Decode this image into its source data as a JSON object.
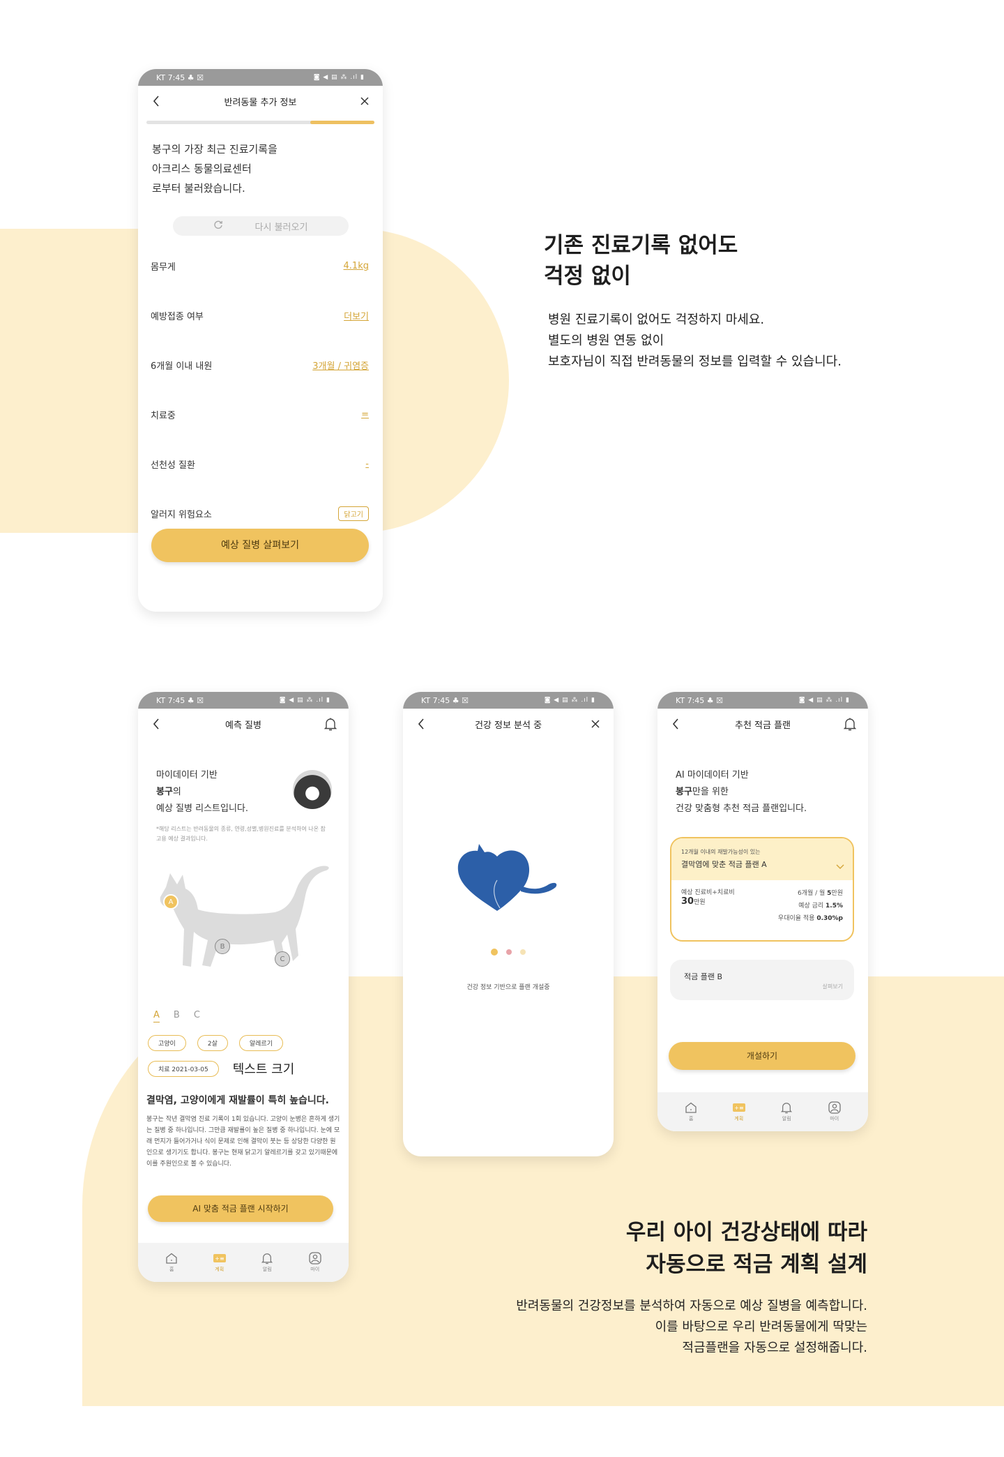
{
  "colors": {
    "accent": "#f0c35f",
    "accent_text": "#d4a537",
    "bg_cream": "#fdefcd",
    "heart_blue": "#2c5fa8"
  },
  "status_bar": {
    "left": "KT 7:45 ♣ ☒",
    "right": "◙ ◀ ▤ ⁂ .ıl ▮"
  },
  "phone1": {
    "title": "반려동물 추가 정보",
    "intro": [
      "봉구의 가장 최근 진료기록을",
      "아크리스 동물의료센터",
      "로부터 불러왔습니다."
    ],
    "reload_label": "다시 불러오기",
    "rows": [
      {
        "label": "몸무게",
        "value": "4.1kg"
      },
      {
        "label": "예방접종 여부",
        "value": "더보기"
      },
      {
        "label": "6개월 이내 내원",
        "value": "3개월 / 귀염증"
      },
      {
        "label": "치료중",
        "value": "="
      },
      {
        "label": "선천성 질환",
        "value": "-"
      },
      {
        "label": "알러지 위험요소",
        "tag": "닭고기"
      }
    ],
    "cta": "예상 질병 살펴보기"
  },
  "phone2": {
    "title": "예측 질병",
    "head": {
      "line1": "마이데이터 기반",
      "name": "봉구",
      "line2_suffix": "의",
      "line3": "예상 질병 리스트입니다."
    },
    "disclaimer": "*해당 리스트는 반려동물의 종류, 연령,성별,병원진료를 분석하여 나온 참고용 예상 결과입니다.",
    "markers": [
      "A",
      "B",
      "C"
    ],
    "tabs_abc": [
      "A",
      "B",
      "C"
    ],
    "chips": [
      "고양이",
      "2살",
      "알레르기",
      "치료 2021-03-05"
    ],
    "chip_note": "텍스트 크기",
    "result_title": "결막염, 고양이에게 재발률이 특히 높습니다.",
    "result_body": "봉구는 작년 결막염 진료 기록이 1회 있습니다. 고양이 눈병은 흔하게 생기는 질병 중 하나입니다. 그만큼 재발률이 높은 질병 중 하나입니다. 눈에 모래 먼지가 들어가거나 식이 문제로 인해 결막이 붓는 등 상당한 다양한 원인으로 생기기도 합니다. 봉구는 현재 닭고기 알레르기를 갖고 있기때문에 이를 주원인으로 볼 수 있습니다.",
    "cta": "AI 맞춤 적금 플랜 시작하기"
  },
  "tabbar": [
    {
      "label": "홈",
      "icon": "home-icon"
    },
    {
      "label": "계획",
      "icon": "plan-icon"
    },
    {
      "label": "알림",
      "icon": "bell-icon"
    },
    {
      "label": "마이",
      "icon": "profile-icon"
    }
  ],
  "phone3": {
    "title": "건강 정보 분석 중",
    "caption": "건강 정보 기반으로 플랜 개설중"
  },
  "phone4": {
    "title": "추천 적금 플랜",
    "head": {
      "line1": "AI 마이데이터 기반",
      "name": "봉구",
      "line2_suffix": "만을 위한",
      "line3": "건강 맞춤형 추천 적금 플랜입니다."
    },
    "plan_a": {
      "subtitle": "12개월 이내의 재발가능성이 있는",
      "title": "결막염에 맞춘 적금 플랜 A",
      "cost_label": "예상 진료비+치료비",
      "cost_value": "30",
      "cost_unit": "만원",
      "term_prefix": "6개월 / 월 ",
      "term_value": "5",
      "term_unit": "만원",
      "rate_prefix": "예상 금리 ",
      "rate_value": "1.5%",
      "bonus_prefix": "우대이율 적용 ",
      "bonus_value": "0.30%p"
    },
    "plan_b": {
      "title": "적금 플랜 B",
      "more": "살펴보기"
    },
    "cta": "개설하기"
  },
  "copy1": {
    "headline_line1": "기존 진료기록 없어도",
    "headline_line2": "걱정 없이",
    "body": [
      "병원 진료기록이 없어도 걱정하지 마세요.",
      "별도의 병원 연동 없이",
      "보호자님이 직접 반려동물의 정보를 입력할 수 있습니다."
    ]
  },
  "copy2": {
    "headline_line1": "우리 아이 건강상태에 따라",
    "headline_line2": "자동으로 적금 계획 설계",
    "body": [
      "반려동물의 건강정보를 분석하여 자동으로 예상 질병을 예측합니다.",
      "이를 바탕으로 우리 반려동물에게 딱맞는",
      "적금플랜을 자동으로 설정해줍니다."
    ]
  }
}
